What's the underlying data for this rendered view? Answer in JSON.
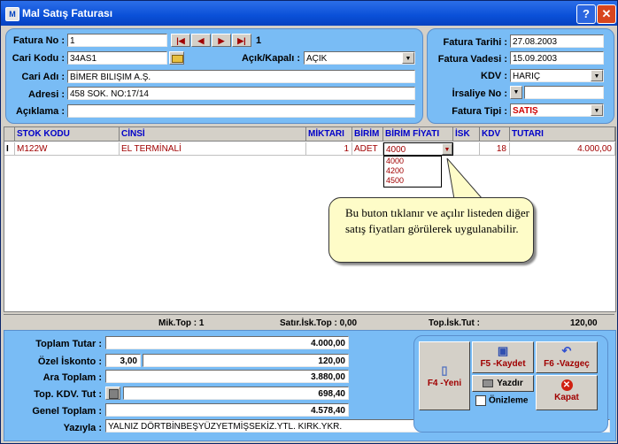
{
  "window": {
    "title": "Mal Satış Faturası",
    "help_label": "?",
    "close_label": "✕"
  },
  "header_left": {
    "fatura_no_label": "Fatura No :",
    "fatura_no": "1",
    "page_number": "1",
    "cari_kodu_label": "Cari Kodu :",
    "cari_kodu": "34AS1",
    "acik_kapali_label": "Açık/Kapalı :",
    "acik_kapali": "AÇIK",
    "cari_adi_label": "Cari Adı :",
    "cari_adi": "BİMER BILIŞIM A.Ş.",
    "adres_label": "Adresi :",
    "adres": "458 SOK. NO:17/14",
    "aciklama_label": "Açıklama :",
    "aciklama": ""
  },
  "header_right": {
    "fatura_tarihi_label": "Fatura Tarihi :",
    "fatura_tarihi": "27.08.2003",
    "fatura_vadesi_label": "Fatura Vadesi :",
    "fatura_vadesi": "15.09.2003",
    "kdv_label": "KDV :",
    "kdv": "HARIÇ",
    "irsaliye_label": "İrsaliye No :",
    "fatura_tipi_label": "Fatura Tipi :",
    "fatura_tipi": "SATIŞ"
  },
  "grid": {
    "headers": [
      "STOK KODU",
      "CİNSİ",
      "MİKTARI",
      "BİRİM",
      "BİRİM FİYATI",
      "İSK",
      "KDV",
      "TUTARI"
    ],
    "row": {
      "indicator": "I",
      "stok_kodu": "M122W",
      "cinsi": "EL TERMİNALİ",
      "miktari": "1",
      "birim": "ADET",
      "birim_fiyati": "4000",
      "isk": "",
      "kdv": "18",
      "tutari": "4.000,00"
    },
    "price_options": [
      "4000",
      "4200",
      "4500"
    ]
  },
  "callout": {
    "text": "Bu buton tıklanır ve açılır listeden diğer satış fiyatları görülerek uygulanabilir."
  },
  "summary_bar": {
    "mik_top": "Mik.Top : 1",
    "satir_isk_top": "Satır.İsk.Top : 0,00",
    "top_isk_tut_label": "Top.İsk.Tut :",
    "top_isk_tut": "120,00"
  },
  "totals": {
    "toplam_tutar_label": "Toplam Tutar :",
    "toplam_tutar": "4.000,00",
    "ozel_iskonto_label": "Özel İskonto :",
    "ozel_iskonto_rate": "3,00",
    "ozel_iskonto": "120,00",
    "ara_toplam_label": "Ara Toplam :",
    "ara_toplam": "3.880,00",
    "top_kdv_label": "Top. KDV. Tut :",
    "top_kdv": "698,40",
    "genel_toplam_label": "Genel Toplam :",
    "genel_toplam": "4.578,40",
    "yazila_label": "Yazıyla :",
    "yazila": "YALNIZ DÖRTBİNBEŞYÜZYETMİŞSEKİZ.YTL. KIRK.YKR."
  },
  "buttons": {
    "yeni": "F4 -Yeni",
    "kaydet": "F5 -Kaydet",
    "vazgec": "F6 -Vazgeç",
    "yazdir": "Yazdır",
    "onizleme": "Önizleme",
    "kapat": "Kapat"
  }
}
